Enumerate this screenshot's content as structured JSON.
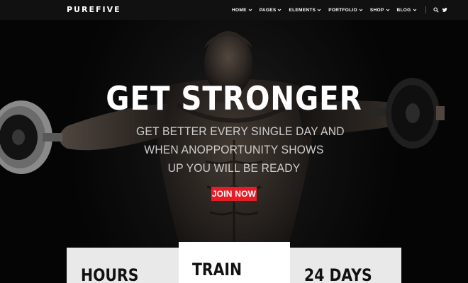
{
  "header": {
    "logo": "PUREFIVE",
    "nav": [
      {
        "label": "HOME"
      },
      {
        "label": "PAGES"
      },
      {
        "label": "ELEMENTS"
      },
      {
        "label": "PORTFOLIO"
      },
      {
        "label": "SHOP"
      },
      {
        "label": "BLOG"
      }
    ],
    "icons": [
      "search-icon",
      "twitter-icon"
    ]
  },
  "hero": {
    "title": "GET STRONGER",
    "subtitle_lines": [
      "GET BETTER EVERY SINGLE DAY AND",
      "WHEN ANOPPORTUNITY SHOWS",
      "UP YOU WILL BE READY"
    ],
    "cta": "JOIN NOW",
    "cta_color": "#e41e26"
  },
  "features": [
    {
      "label": "HOURS"
    },
    {
      "label": "TRAIN"
    },
    {
      "label": "24 DAYS"
    }
  ]
}
